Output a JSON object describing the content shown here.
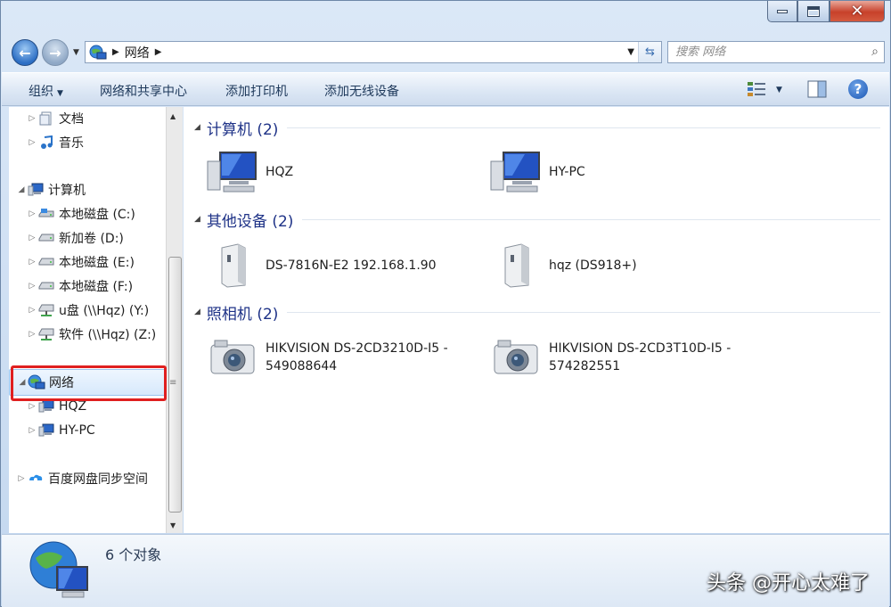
{
  "nav": {
    "crumbs": [
      "网络"
    ],
    "search_placeholder": "搜索 网络"
  },
  "cmdbar": {
    "organize": "组织",
    "network_center": "网络和共享中心",
    "add_printer": "添加打印机",
    "add_wireless": "添加无线设备",
    "help": "?"
  },
  "tree": [
    {
      "label": "文档",
      "icon": "documents-icon"
    },
    {
      "label": "音乐",
      "icon": "music-icon"
    },
    {
      "label": "计算机",
      "icon": "computer-icon"
    },
    {
      "label": "本地磁盘 (C:)",
      "icon": "system-drive-icon"
    },
    {
      "label": "新加卷 (D:)",
      "icon": "drive-icon"
    },
    {
      "label": "本地磁盘 (E:)",
      "icon": "drive-icon"
    },
    {
      "label": "本地磁盘 (F:)",
      "icon": "drive-icon"
    },
    {
      "label": "u盘 (\\\\Hqz) (Y:)",
      "icon": "network-drive-icon"
    },
    {
      "label": "软件 (\\\\Hqz) (Z:)",
      "icon": "network-drive-icon"
    },
    {
      "label": "网络",
      "icon": "network-globe-icon",
      "selected": true
    },
    {
      "label": "HQZ",
      "icon": "computer-icon"
    },
    {
      "label": "HY-PC",
      "icon": "computer-icon"
    },
    {
      "label": "百度网盘同步空间",
      "icon": "baidu-cloud-icon"
    }
  ],
  "groups": {
    "computers": {
      "label": "计算机 (2)",
      "items": [
        "HQZ",
        "HY-PC"
      ]
    },
    "other": {
      "label": "其他设备 (2)",
      "items": [
        "DS-7816N-E2 192.168.1.90",
        "hqz (DS918+)"
      ]
    },
    "cameras": {
      "label": "照相机 (2)",
      "items": [
        {
          "line1": "HIKVISION DS-2CD3210D-I5 -",
          "line2": "549088644"
        },
        {
          "line1": "HIKVISION DS-2CD3T10D-I5 -",
          "line2": "574282551"
        }
      ]
    }
  },
  "details": {
    "count": "6 个对象"
  },
  "watermark": "头条 @开心太难了",
  "colors": {
    "group_header": "#1e3287",
    "highlight": "#e02020"
  }
}
